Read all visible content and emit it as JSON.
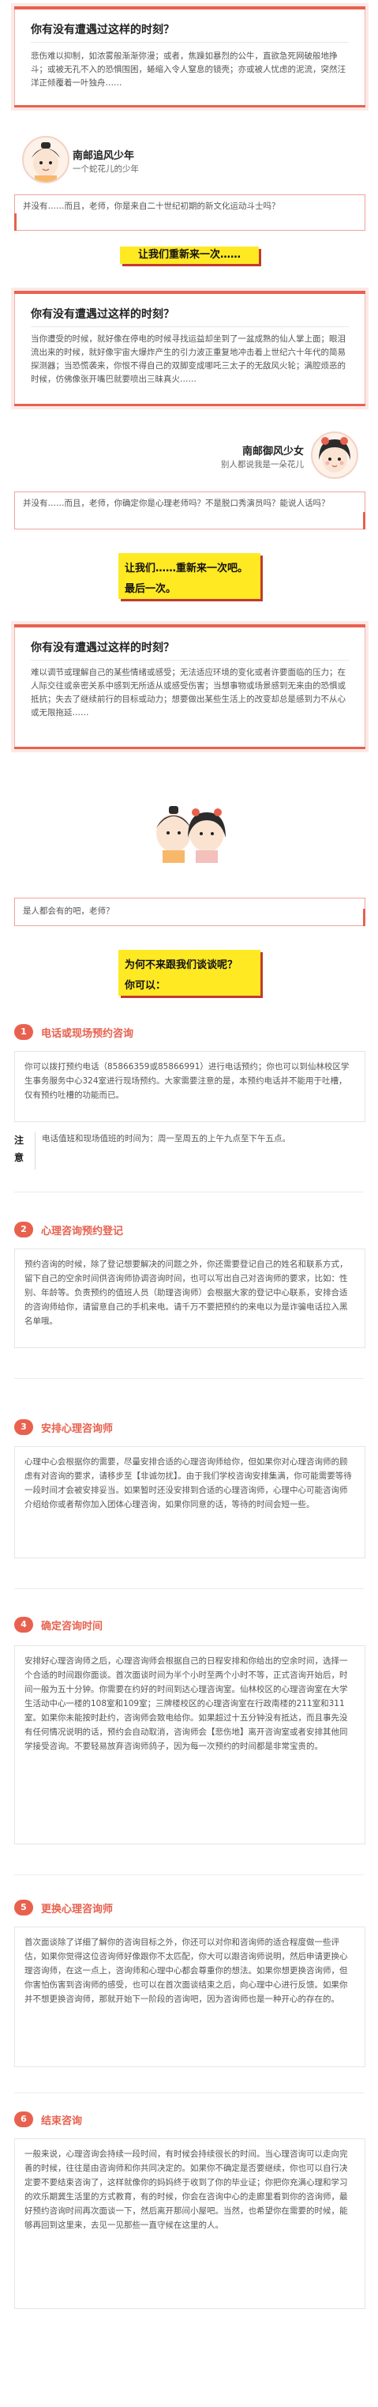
{
  "card1": {
    "title": "你有没有遭遇过这样的时刻？",
    "body": "悲伤难以抑制，如浓雾般渐渐弥漫；或者，焦躁如暴烈的公牛，直欲急死网破般地挣斗；或被无孔不入的恐惧围困，蜷缩入令人窒息的镜壳；亦或被人忧虑的泥流，突然汪洋正倾覆着一叶独舟……"
  },
  "persona1": {
    "name": "南邮追风少年",
    "sub": "一个蛇花儿的少年"
  },
  "chat1": "并没有……而且，老师，你是来自二十世纪初期的新文化运动斗士吗？",
  "hl1": "让我们重新来一次……",
  "card2": {
    "title": "你有没有遭遇过这样的时刻？",
    "body": "当你遭受的时候，就好像在停电的时候寻找运益却坐到了一盆成熟的仙人掌上面；眼泪流出来的时候，就好像宇宙大爆炸产生的引力波正重复地冲击着上世纪六十年代的简易探测器；当恐慌袭来，你恨不得自己的双脚变成哪吒三太子的无敌风火轮；满腔烦恶的时候，仿佛像张开嘴巴就要喷出三昧真火……"
  },
  "persona2": {
    "name": "南邮御风少女",
    "sub": "别人都说我是一朵花儿"
  },
  "chat2": "并没有……而且，老师，你确定你是心理老师吗？不是脱口秀演员吗？能说人话吗？",
  "hl2": {
    "line1": "让我们……重新来一次吧。",
    "line2": "最后一次。"
  },
  "card3": {
    "title": "你有没有遭遇过这样的时刻？",
    "body": "难以调节或理解自己的某些情绪或感受；无法适应环境的变化或者许要面临的压力；在人际交往或亲密关系中感到无所适从或感受伤害；当想事物或场景感到无来由的恐惧或抵抗；失去了继续前行的目标或动力；想要做出某些生活上的改变却总是感到力不从心或无限拖延……"
  },
  "chat3": "是人都会有的吧，老师？",
  "hl3": {
    "line1": "为何不来跟我们谈谈呢？",
    "line2": "你可以："
  },
  "sections": [
    {
      "num": "1",
      "title": "电话或现场预约咨询",
      "body": "你可以拨打预约电话（85866359或85866991）进行电话预约；你也可以到仙林校区学生事务服务中心324室进行现场预约。大家需要注意的是，本预约电话并不能用于吐槽，仅有预约吐槽的功能而已。",
      "note_tag": "注意",
      "note": "电话值班和现场值班的时间为：周一至周五的上午九点至下午五点。"
    },
    {
      "num": "2",
      "title": "心理咨询预约登记",
      "body": "预约咨询的时候，除了登记想要解决的问题之外，你还需要登记自己的姓名和联系方式，留下自己的空余时间供咨询师协调咨询时间，也可以写出自己对咨询师的要求，比如：性别、年龄等。负责预约的值班人员（助理咨询师）会根据大家的登记中心联系，安排合适的咨询师给你，请留意自己的手机来电。请千万不要把预约的来电以为是诈骗电话拉入黑名单哦。"
    },
    {
      "num": "3",
      "title": "安排心理咨询师",
      "body": "心理中心会根据你的需要，尽量安排合适的心理咨询师给你，但如果你对心理咨询师的顾虑有对咨询的要求，请移步至【非诚勿扰】。由于我们学校咨询安排集满，你可能需要等待一段时间才会被安排妥当。如果暂时还没安排到合适的心理咨询师，心理中心可能咨询师介绍给你或者帮你加入团体心理咨询，如果你同意的话，等待的时间会短一些。"
    },
    {
      "num": "4",
      "title": "确定咨询时间",
      "body": "安排好心理咨询师之后，心理咨询师会根据自己的日程安排和你给出的空余时间，选择一个合适的时间跟你面谈。首次面谈时间为半个小时至两个小时不等，正式咨询开始后，时间一般为五十分钟。你需要在约好的时间到达心理咨询室。仙林校区的心理咨询室在大学生活动中心一楼的108室和109室；三牌楼校区的心理咨询室在行政南楼的211室和311室。如果你未能按时赴约，咨询师会致电给你。如果超过十五分钟没有抵达，而且事先没有任何情况说明的话，预约会自动取消，咨询师会【悲伤地】离开咨询室或者安排其他同学接受咨询。不要轻易放弃咨询师鸽子，因为每一次预约的时间都是非常宝贵的。"
    },
    {
      "num": "5",
      "title": "更换心理咨询师",
      "body": "首次面谈除了详细了解你的咨询目标之外，你还可以对你和咨询师的适合程度做一些评估，如果你觉得这位咨询师好像跟你不太匹配，你大可以跟咨询师说明，然后申请更换心理咨询师，在这一点上，咨询师和心理中心都会尊重你的想法。如果你想更换咨询师，但你害怕伤害到咨询师的感受，也可以在首次面谈结束之后，向心理中心进行反馈。如果你并不想更换咨询师，那就开始下一阶段的咨询吧，因为咨询师也是一种开心的存在的。"
    },
    {
      "num": "6",
      "title": "结束咨询",
      "body": "一般来说，心理咨询会持续一段时间，有时候会持续很长的时间。当心理咨询可以走向完善的时候，往往是由咨询师和你共同决定的。如果你不确定是否要继续，你也可以自行决定要不要结束咨询了，这样就像你的妈妈终于收到了你的毕业证；你把你充满心理和学习的欢乐期冀生活里的方式教育，有的时候，你会在咨询中心的走廊里看到你的咨询师，最好预约咨询时间再次面谈一下，然后离开那间小屋吧。当然，也希望你在需要的时候，能够再回到这里来，去见一见那些一直守候在这里的人。"
    }
  ],
  "colors": {
    "accent": "#e8614f",
    "highlight": "#ffe923",
    "shadow": "#c23a30"
  },
  "icons": [
    "boy-avatar",
    "girl-avatar",
    "couple-illustration"
  ]
}
